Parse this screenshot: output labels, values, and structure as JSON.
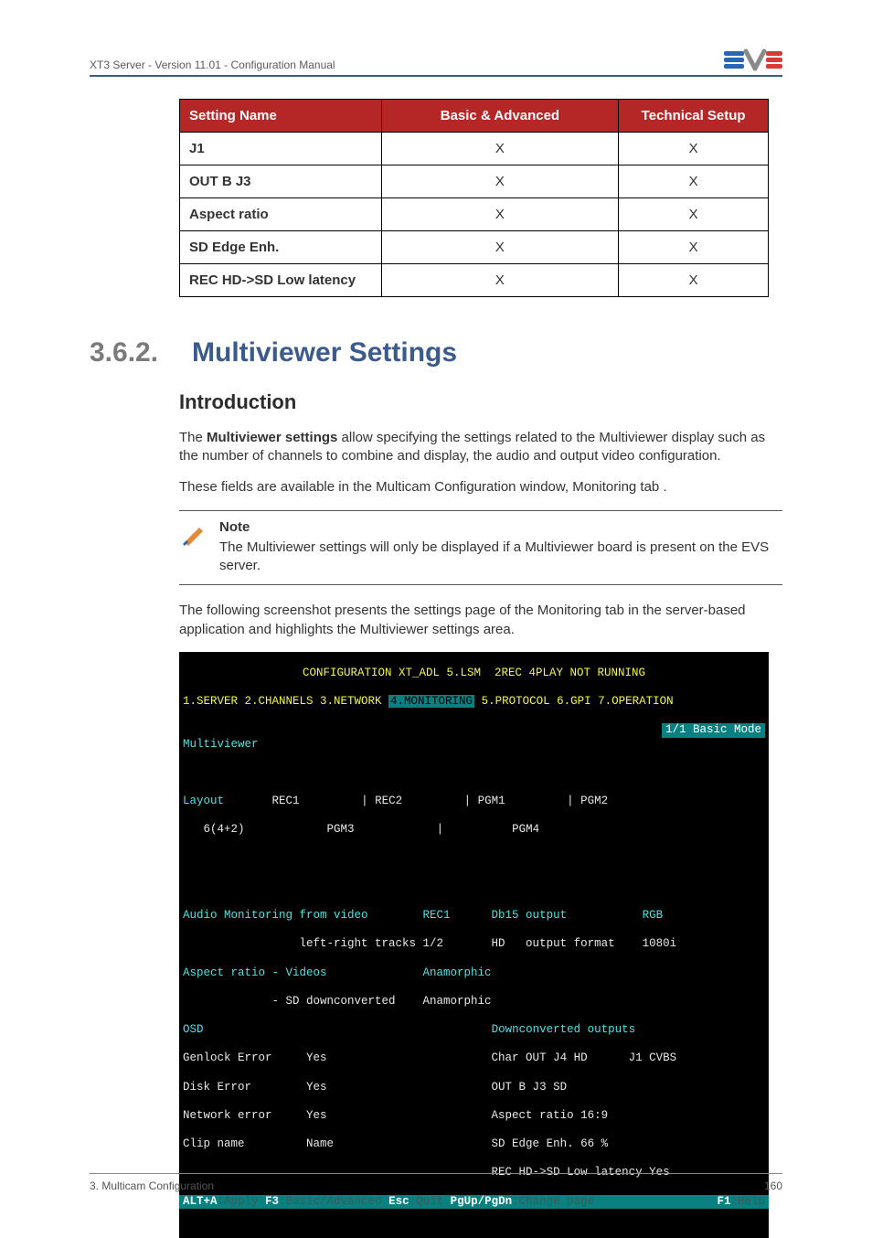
{
  "header": {
    "doc_title": "XT3 Server - Version 11.01 - Configuration Manual"
  },
  "settings_table": {
    "headers": [
      "Setting Name",
      "Basic & Advanced",
      "Technical Setup"
    ],
    "rows": [
      {
        "name": "J1",
        "ba": "X",
        "ts": "X"
      },
      {
        "name": "OUT B J3",
        "ba": "X",
        "ts": "X"
      },
      {
        "name": "Aspect ratio",
        "ba": "X",
        "ts": "X"
      },
      {
        "name": "SD Edge Enh.",
        "ba": "X",
        "ts": "X"
      },
      {
        "name": "REC HD->SD Low latency",
        "ba": "X",
        "ts": "X"
      }
    ]
  },
  "section": {
    "number": "3.6.2.",
    "title": "Multiviewer Settings",
    "intro_heading": "Introduction",
    "para1_a": "The ",
    "para1_b_bold": "Multiviewer settings",
    "para1_c": " allow specifying the settings related to the Multiviewer display such as the number of channels to combine and display, the audio and output video configuration.",
    "para2": "These fields are available in the Multicam Configuration window, Monitoring tab .",
    "note_title": "Note",
    "note_body": "The Multiviewer settings will only be displayed if a Multiviewer board is present on the EVS server.",
    "para3": "The following screenshot presents the settings page of the Monitoring tab in the server-based application and highlights the Multiviewer settings area."
  },
  "terminal": {
    "title": "CONFIGURATION XT_ADL 5.LSM  2REC 4PLAY NOT RUNNING",
    "menu_pre": "1.SERVER 2.CHANNELS 3.NETWORK ",
    "menu_sel": "4.MONITORING",
    "menu_post": " 5.PROTOCOL 6.GPI 7.OPERATION",
    "mode": "1/1 Basic Mode",
    "section_label": "Multiviewer",
    "layout_label": "Layout",
    "layout_cells": [
      "REC1",
      "| REC2",
      "| PGM1",
      "| PGM2"
    ],
    "layout_val": "6(4+2)",
    "layout_cells2": [
      "PGM3",
      "",
      "PGM4",
      ""
    ],
    "audio_line": "Audio Monitoring from video        REC1      Db15 output           RGB",
    "audio_line2": "                 left-right tracks 1/2       HD   output format    1080i",
    "aspect_line": "Aspect ratio - Videos              Anamorphic",
    "aspect_line2": "             - SD downconverted    Anamorphic",
    "osd_label": "OSD",
    "down_label": "Downconverted outputs",
    "osd_rows": [
      "Genlock Error     Yes                        Char OUT J4 HD      J1 CVBS",
      "Disk Error        Yes                        OUT B J3 SD",
      "Network error     Yes                        Aspect ratio 16:9",
      "Clip name         Name                       SD Edge Enh. 66 %",
      "                                             REC HD->SD Low latency Yes"
    ],
    "bottom_bar_parts": {
      "p1": "ALT+A",
      "p1b": ":Apply ",
      "p2": "F3",
      "p2b": ":Basic/Advanced ",
      "p3": "Esc",
      "p3b": ":Quit ",
      "p4": "PgUp/PgDn",
      "p4b": ":Change page",
      "right1": "F1",
      "right2": ":Help"
    }
  },
  "footer": {
    "left": "3. Multicam Configuration",
    "right": "160"
  }
}
